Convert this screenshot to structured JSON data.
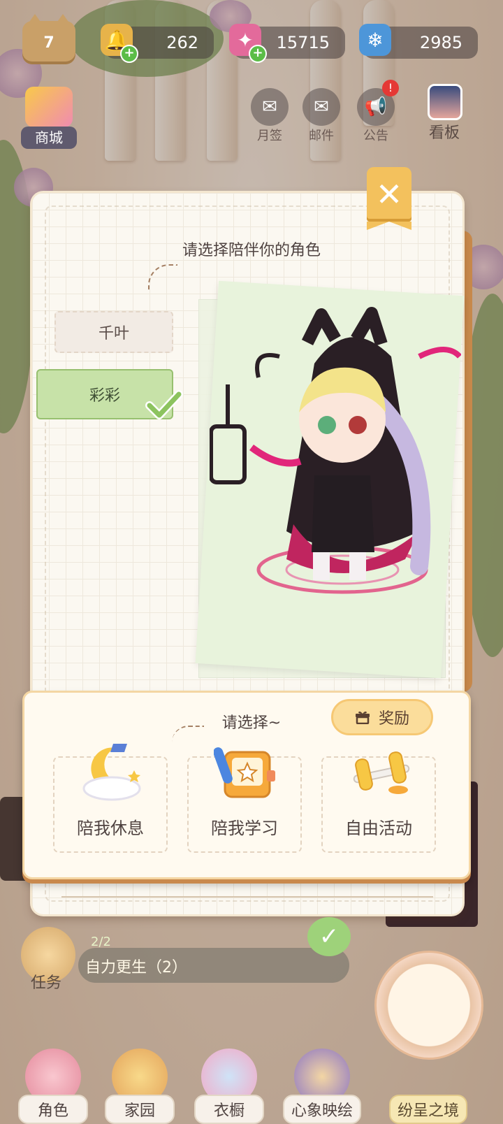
{
  "hud": {
    "level": "7",
    "currencies": [
      {
        "name": "bell-currency",
        "value": "262"
      },
      {
        "name": "gem-currency",
        "value": "15715"
      },
      {
        "name": "snowflake-currency",
        "value": "2985"
      }
    ],
    "shop_label": "商城",
    "top_icons": [
      {
        "name": "monthly-signin",
        "label": "月签"
      },
      {
        "name": "mail",
        "label": "邮件"
      },
      {
        "name": "announcement",
        "label": "公告"
      }
    ],
    "board_label": "看板"
  },
  "dialog": {
    "prompt": "请选择陪伴你的角色",
    "characters": [
      {
        "name": "千叶",
        "selected": false
      },
      {
        "name": "彩彩",
        "selected": true
      }
    ],
    "choose_prompt": "请选择~",
    "reward_label": "奖励",
    "options": [
      {
        "label": "陪我休息",
        "icon": "moon-cloud-icon"
      },
      {
        "label": "陪我学习",
        "icon": "notebook-pen-icon"
      },
      {
        "label": "自由活动",
        "icon": "dumbbell-icon"
      }
    ]
  },
  "task": {
    "label": "任务",
    "progress": "2/2",
    "title": "自力更生（2）"
  },
  "nav": [
    {
      "label": "角色"
    },
    {
      "label": "家园"
    },
    {
      "label": "衣橱"
    },
    {
      "label": "心象映绘"
    },
    {
      "label": "纷呈之境"
    }
  ],
  "colors": {
    "selected_green": "#c7e2a8",
    "accent_gold": "#f3c15d",
    "panel_cream": "#fffaf0"
  }
}
